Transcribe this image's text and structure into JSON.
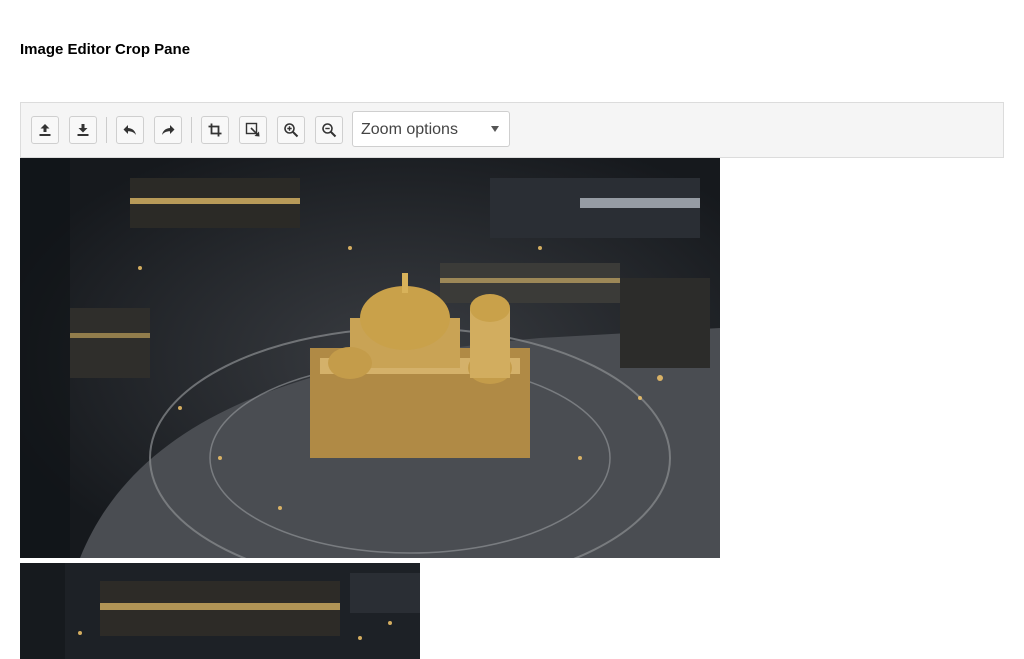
{
  "page_title": "Image Editor Crop Pane",
  "toolbar": {
    "buttons": [
      {
        "name": "open",
        "icon": "upload-icon"
      },
      {
        "name": "save",
        "icon": "download-icon"
      },
      {
        "name": "undo",
        "icon": "undo-icon"
      },
      {
        "name": "redo",
        "icon": "redo-icon"
      },
      {
        "name": "crop",
        "icon": "crop-icon"
      },
      {
        "name": "pan",
        "icon": "pan-icon"
      },
      {
        "name": "zoom_in",
        "icon": "zoom-in-icon"
      },
      {
        "name": "zoom_out",
        "icon": "zoom-out-icon"
      }
    ],
    "zoom_placeholder": "Zoom options"
  },
  "colors": {
    "toolbar_bg": "#f5f5f5",
    "toolbar_border": "#dcdcdc",
    "icon": "#333333",
    "night_sky": "#1b1f24",
    "city_lights": "#f2c46a",
    "cathedral_dome": "#c9a14a"
  }
}
